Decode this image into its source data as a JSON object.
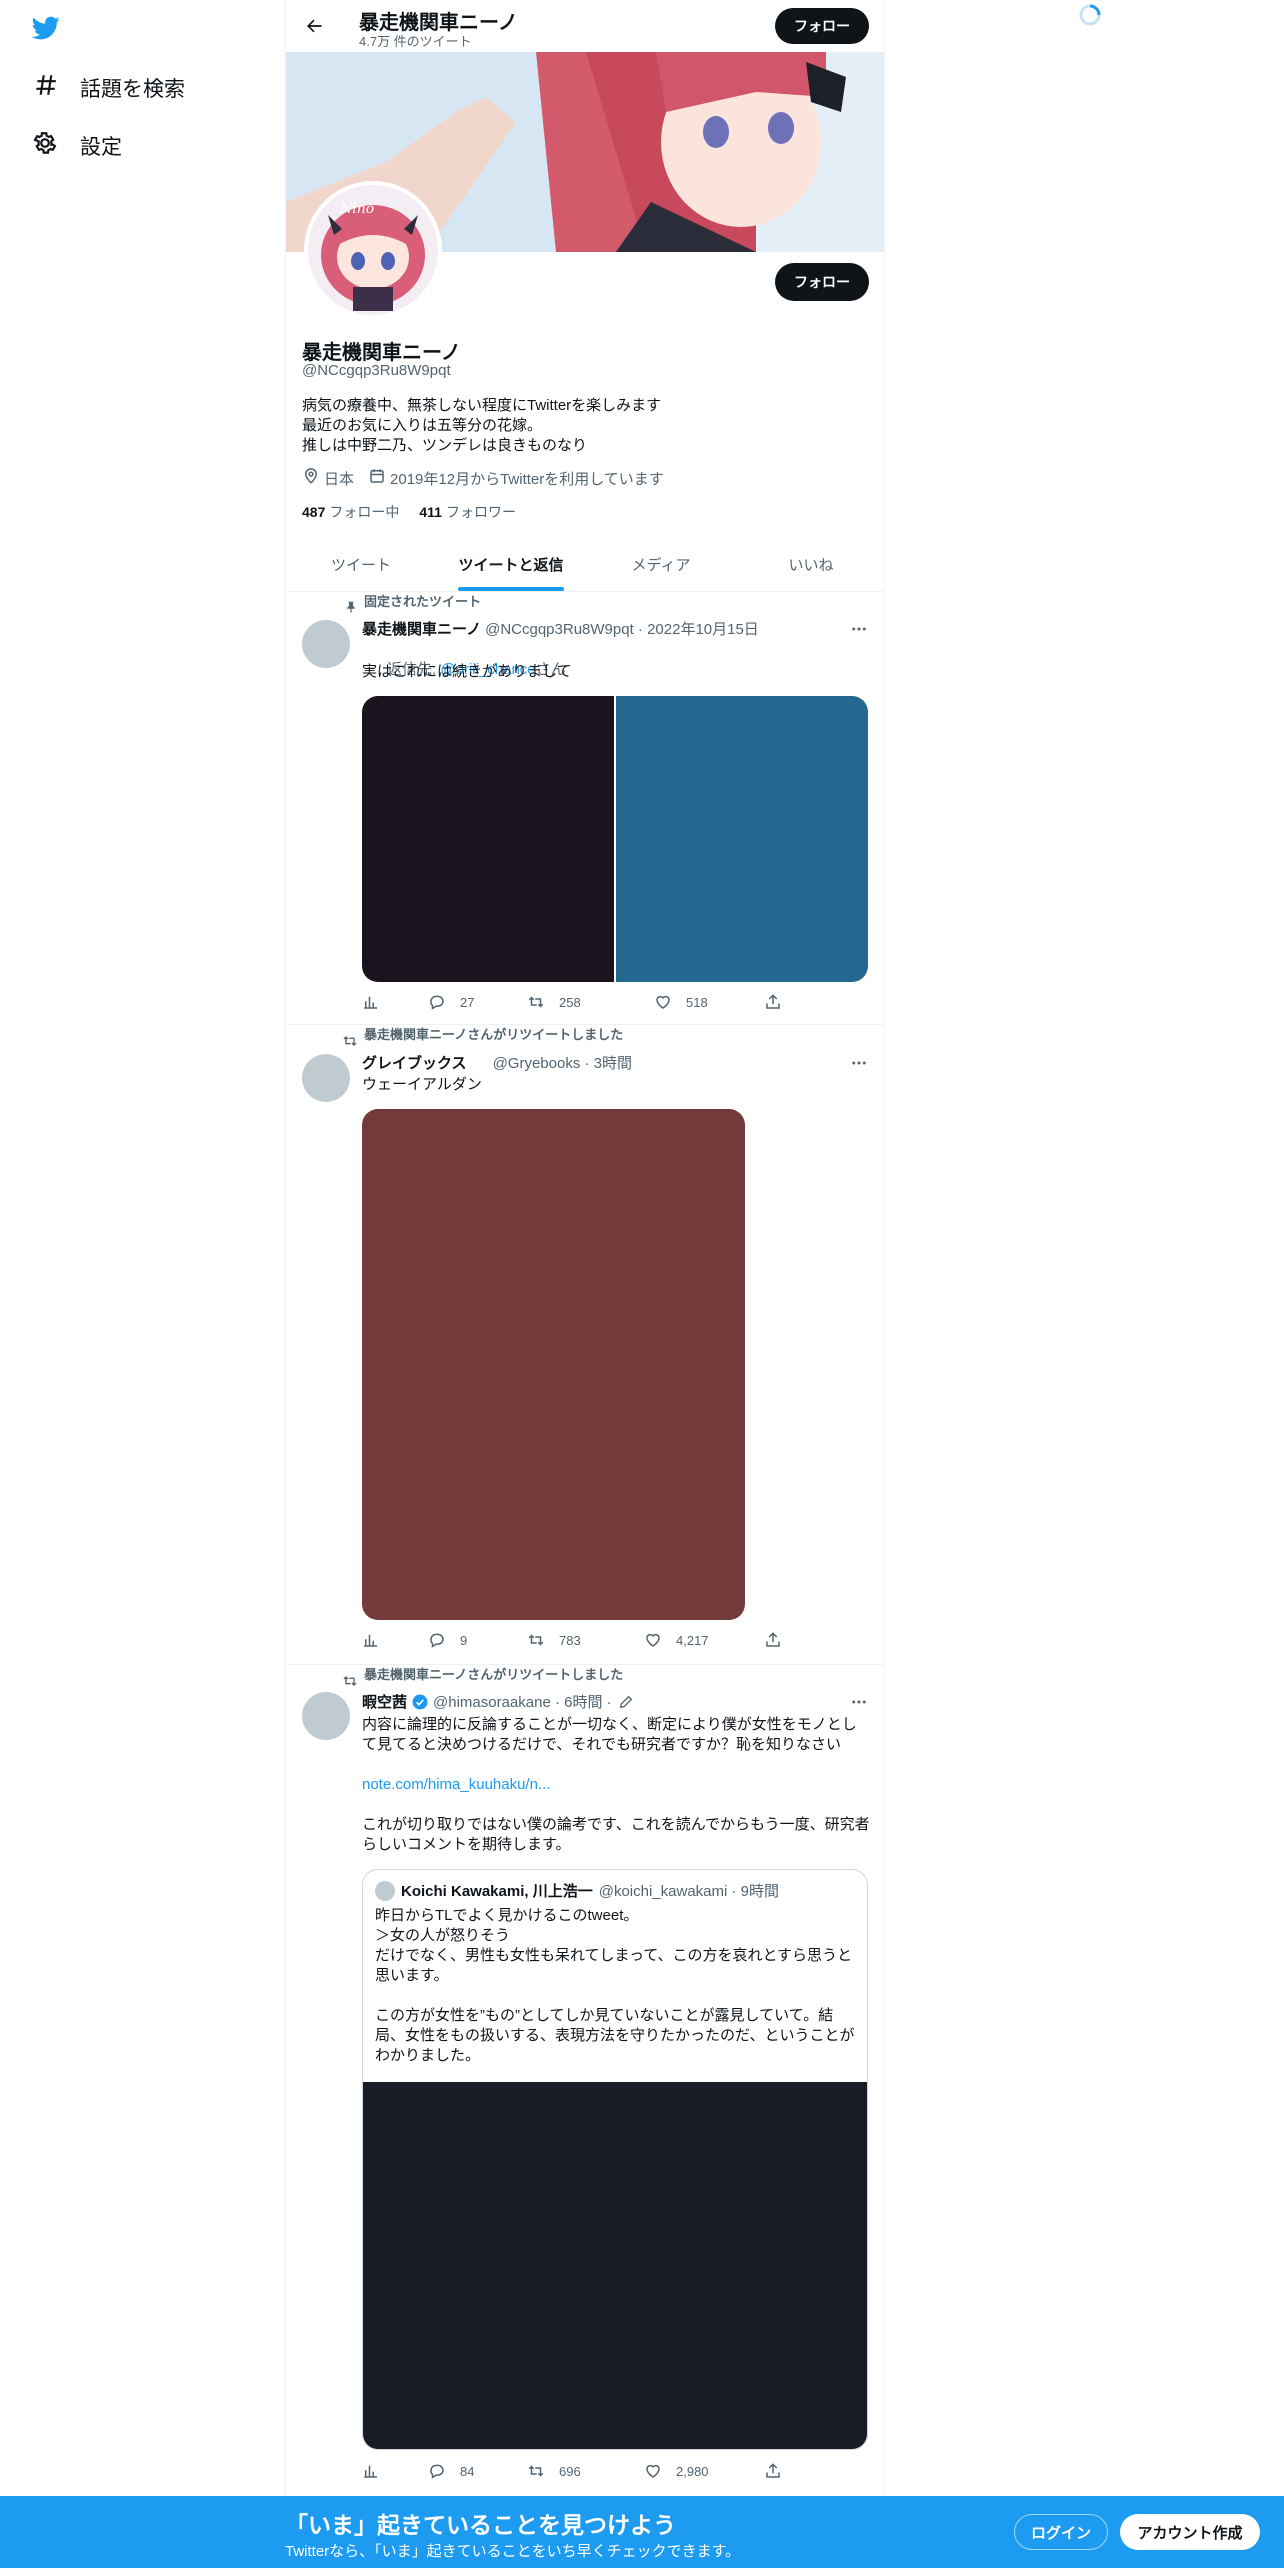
{
  "nav": {
    "explore_label": "話題を検索",
    "settings_label": "設定"
  },
  "header": {
    "title": "暴走機関車ニーノ",
    "subtitle": "4.7万 件のツイート",
    "follow_label": "フォロー"
  },
  "profile": {
    "name": "暴走機関車ニーノ",
    "handle": "@NCcgqp3Ru8W9pqt",
    "bio": "病気の療養中、無茶しない程度にTwitterを楽しみます\n最近のお気に入りは五等分の花嫁。\n推しは中野二乃、ツンデレは良きものなり",
    "location": "日本",
    "joined": "2019年12月からTwitterを利用しています",
    "following_count": "487",
    "following_label": "フォロー中",
    "followers_count": "411",
    "followers_label": "フォロワー",
    "follow_label": "フォロー",
    "avatar_text": "Nino"
  },
  "tabs": [
    "ツイート",
    "ツイートと返信",
    "メディア",
    "いいね"
  ],
  "tweets": [
    {
      "context": "固定されたツイート",
      "name": "暴走機関車ニーノ",
      "meta": "@NCcgqp3Ru8W9pqt · 2022年10月15日",
      "reply_to_prefix": "返信先: ",
      "reply_to_user": "@oriii_chance",
      "reply_to_suffix": "さん",
      "text": "実はこれには続きがありまして",
      "replies": "27",
      "retweets": "258",
      "likes": "518"
    },
    {
      "context": "暴走機関車ニーノさんがリツイートしました",
      "name": "グレイブックス",
      "meta": "@Gryebooks · 3時間",
      "text": "ウェーイアルダン",
      "replies": "9",
      "retweets": "783",
      "likes": "4,217"
    },
    {
      "context": "暴走機関車ニーノさんがリツイートしました",
      "name": "暇空茜",
      "meta": "@himasoraakane · 6時間 ·",
      "text_1": "内容に論理的に反論することが一切なく、断定により僕が女性をモノとして見てると決めつけるだけで、それでも研究者ですか？恥を知りなさい",
      "link": "note.com/hima_kuuhaku/n...",
      "text_2": "これが切り取りではない僕の論考です、これを読んでからもう一度、研究者らしいコメントを期待します。",
      "quote_name": "Koichi Kawakami, 川上浩一",
      "quote_meta": "@koichi_kawakami · 9時間",
      "quote_text": "昨日からTLでよく見かけるこのtweet。\n＞女の人が怒りそう\nだけでなく、男性も女性も呆れてしまって、この方を哀れとすら思うと思います。\n\nこの方が女性を”もの”としてしか見ていないことが露見していて。結局、女性をもの扱いする、表現方法を守りたかったのだ、ということがわかりました。",
      "replies": "84",
      "retweets": "696",
      "likes": "2,980"
    }
  ],
  "bottom_bar": {
    "title": "「いま」起きていることを見つけよう",
    "subtitle": "Twitterなら、「いま」起きていることをいち早くチェックできます。",
    "login_label": "ログイン",
    "signup_label": "アカウント作成"
  },
  "colors": {
    "accent": "#1d9bf0",
    "text": "#0f1419",
    "secondary": "#536471",
    "media_1": "#1b141e",
    "media_2": "#246892",
    "media_3": "#733a3a",
    "media_4": "#181c26"
  }
}
